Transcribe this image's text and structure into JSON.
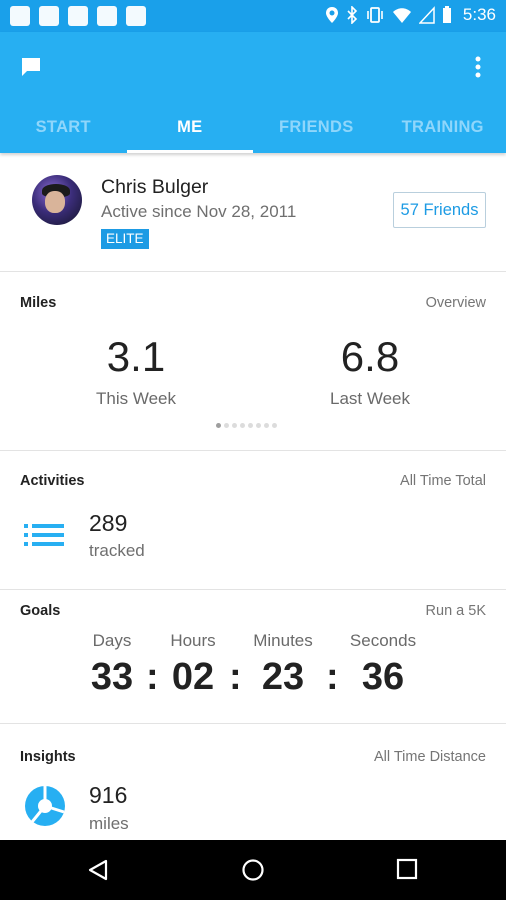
{
  "status_bar": {
    "time": "5:36"
  },
  "app_bar": {
    "tabs": [
      {
        "label": "START"
      },
      {
        "label": "ME"
      },
      {
        "label": "FRIENDS"
      },
      {
        "label": "TRAINING"
      }
    ],
    "active_tab": "ME",
    "colors": {
      "bar": "#27aff2",
      "status": "#1aa0ea",
      "accent": "#1d9be4"
    }
  },
  "profile": {
    "name": "Chris Bulger",
    "since": "Active since Nov 28, 2011",
    "badge": "ELITE",
    "friends_button": "57 Friends"
  },
  "miles": {
    "title": "Miles",
    "link": "Overview",
    "this_week_value": "3.1",
    "this_week_label": "This Week",
    "last_week_value": "6.8",
    "last_week_label": "Last Week",
    "page_dots": 8,
    "active_dot": 1
  },
  "activities": {
    "title": "Activities",
    "link": "All Time Total",
    "count": "289",
    "caption": "tracked"
  },
  "goals": {
    "title": "Goals",
    "link": "Run a 5K",
    "countdown": [
      {
        "label": "Days",
        "value": "33"
      },
      {
        "label": "Hours",
        "value": "02"
      },
      {
        "label": "Minutes",
        "value": "23"
      },
      {
        "label": "Seconds",
        "value": "36"
      }
    ],
    "separator": ":"
  },
  "insights": {
    "title": "Insights",
    "link": "All Time Distance",
    "value": "916",
    "caption": "miles"
  }
}
